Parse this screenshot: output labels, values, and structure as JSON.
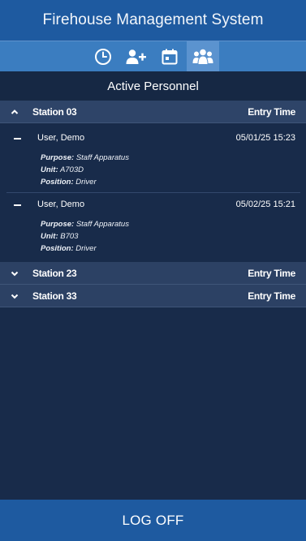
{
  "app": {
    "title": "Firehouse Management System"
  },
  "nav": {
    "tabs": [
      {
        "icon": "clock-icon"
      },
      {
        "icon": "add-user-icon"
      },
      {
        "icon": "calendar-icon"
      },
      {
        "icon": "group-icon",
        "active": true
      }
    ]
  },
  "section": {
    "title": "Active Personnel"
  },
  "stations": [
    {
      "name": "Station 03",
      "column_label": "Entry Time",
      "expanded": true,
      "personnel": [
        {
          "name": "User, Demo",
          "time": "05/01/25 15:23",
          "purpose_label": "Purpose:",
          "purpose": "Staff Apparatus",
          "unit_label": "Unit:",
          "unit": "A703D",
          "position_label": "Position:",
          "position": "Driver"
        },
        {
          "name": "User, Demo",
          "time": "05/02/25 15:21",
          "purpose_label": "Purpose:",
          "purpose": "Staff Apparatus",
          "unit_label": "Unit:",
          "unit": "B703",
          "position_label": "Position:",
          "position": "Driver"
        }
      ]
    },
    {
      "name": "Station 23",
      "column_label": "Entry Time",
      "expanded": false
    },
    {
      "name": "Station 33",
      "column_label": "Entry Time",
      "expanded": false
    }
  ],
  "footer": {
    "logoff_label": "LOG OFF"
  },
  "colors": {
    "header": "#1e5aa0",
    "nav": "#3b7dc0",
    "nav_active": "#5b93cf",
    "background": "#182b4a",
    "group_header": "#2e4468"
  }
}
